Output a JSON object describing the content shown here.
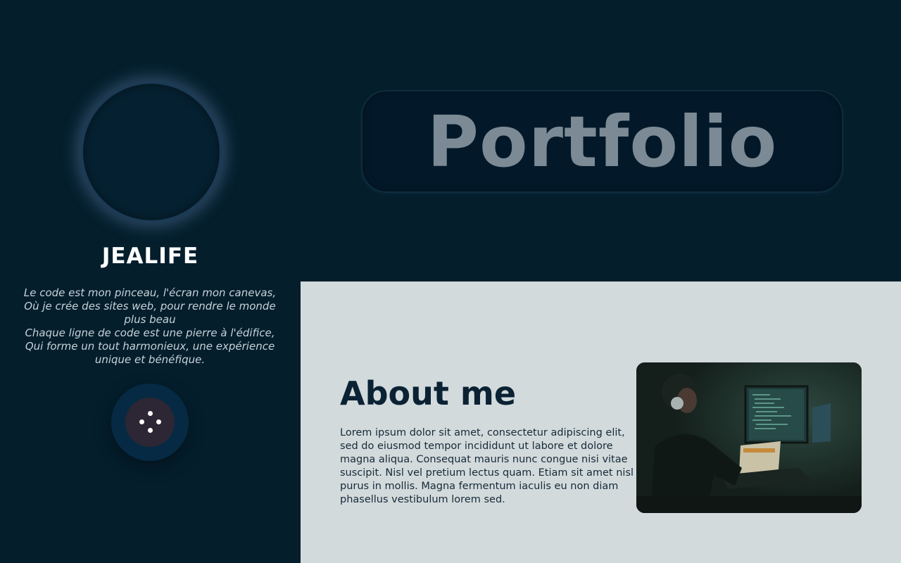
{
  "profile": {
    "name": "JEALIFE",
    "tagline_lines": [
      "Le code est mon pinceau, l'écran mon canevas, Où je crée des sites web, pour rendre le monde plus beau",
      "Chaque ligne de code est une pierre à l'édifice, Qui forme un tout harmonieux, une expérience unique et bénéfique."
    ]
  },
  "header": {
    "title": "Portfolio"
  },
  "about": {
    "heading": "About me",
    "body": "Lorem ipsum dolor sit amet, consectetur adipiscing elit, sed do eiusmod tempor incididunt ut labore et dolore magna aliqua. Consequat mauris nunc congue nisi vitae suscipit. Nisl vel pretium lectus quam. Etiam sit amet nisl purus in mollis. Magna fermentum iaculis eu non diam phasellus vestibulum lorem sed."
  },
  "icons": {
    "action_button": "dots-icon"
  },
  "colors": {
    "background": "#041e2c",
    "about_panel": "#d3dadc",
    "title_text": "#7b8a94",
    "heading_dark": "#0a2233",
    "action_outer": "#062a44",
    "action_inner": "#2d2635"
  }
}
